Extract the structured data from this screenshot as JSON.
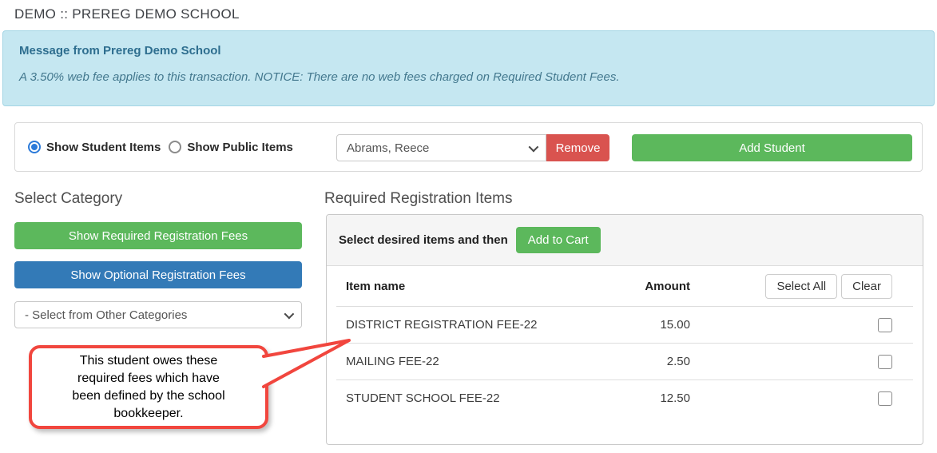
{
  "page": {
    "title": "DEMO :: PREREG DEMO SCHOOL"
  },
  "message_box": {
    "title": "Message from Prereg Demo School",
    "body": "A 3.50% web fee applies to this transaction. NOTICE: There are no web fees charged on Required Student Fees."
  },
  "toolbar": {
    "radio_student": {
      "label": "Show Student Items",
      "selected": true
    },
    "radio_public": {
      "label": "Show Public Items",
      "selected": false
    },
    "student_select_value": "Abrams, Reece",
    "remove_label": "Remove",
    "add_student_label": "Add Student"
  },
  "categories": {
    "heading": "Select Category",
    "required_button_label": "Show Required Registration Fees",
    "optional_button_label": "Show Optional Registration Fees",
    "other_select_value": "- Select from Other Categories"
  },
  "callout": {
    "text": "This student owes these\nrequired fees which have\nbeen defined by the school\nbookkeeper."
  },
  "items_panel": {
    "heading": "Required Registration Items",
    "instruction": "Select desired items and then",
    "add_to_cart_label": "Add to Cart",
    "columns": {
      "item": "Item name",
      "amount": "Amount"
    },
    "select_all_label": "Select All",
    "clear_label": "Clear",
    "rows": [
      {
        "name": "DISTRICT REGISTRATION FEE-22",
        "amount": "15.00",
        "checked": false
      },
      {
        "name": "MAILING FEE-22",
        "amount": "2.50",
        "checked": false
      },
      {
        "name": "STUDENT SCHOOL FEE-22",
        "amount": "12.50",
        "checked": false
      }
    ]
  },
  "colors": {
    "success_green": "#5cb85c",
    "primary_blue": "#337ab7",
    "danger_red": "#d9534f",
    "callout_red": "#f1463e",
    "info_bg": "#c5e7f1",
    "info_text": "#2e6e8f",
    "radio_blue": "#2b7ad9"
  }
}
